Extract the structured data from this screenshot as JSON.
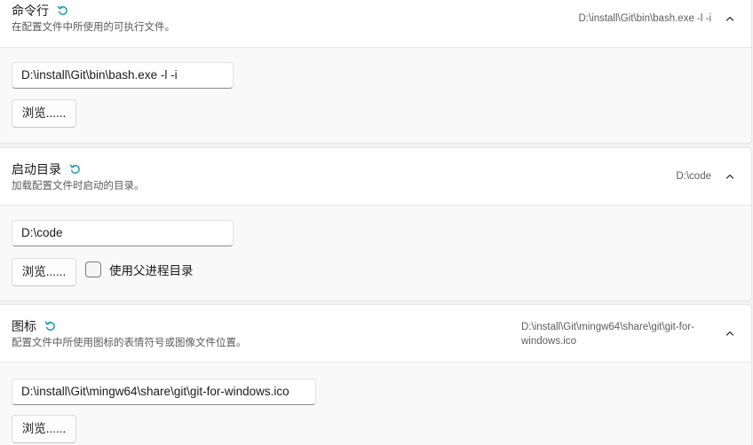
{
  "sections": [
    {
      "title": "命令行",
      "description": "在配置文件中所使用的可执行文件。",
      "value_lines": [
        "D:\\install\\Git\\bin\\bash.exe -l -i"
      ],
      "input_value": "D:\\install\\Git\\bin\\bash.exe -l -i",
      "browse_label": "浏览......",
      "reset_icon": "reset-icon",
      "collapse_icon": "chevron-up-icon"
    },
    {
      "title": "启动目录",
      "description": "加载配置文件时启动的目录。",
      "value_lines": [
        "D:\\code"
      ],
      "input_value": "D:\\code",
      "browse_label": "浏览......",
      "checkbox_label": "使用父进程目录",
      "checkbox_checked": false,
      "reset_icon": "reset-icon",
      "collapse_icon": "chevron-up-icon"
    },
    {
      "title": "图标",
      "description": "配置文件中所使用图标的表情符号或图像文件位置。",
      "value_lines": [
        "D:\\install\\Git\\mingw64\\share\\git\\git-for-",
        "windows.ico"
      ],
      "input_value": "D:\\install\\Git\\mingw64\\share\\git\\git-for-windows.ico",
      "browse_label": "浏览......",
      "reset_icon": "reset-icon",
      "collapse_icon": "chevron-up-icon"
    }
  ],
  "colors": {
    "accent": "#0f9ab0",
    "header_bg": "#ffffff",
    "body_bg": "#f9f9f9",
    "page_bg": "#f3f3f3"
  }
}
